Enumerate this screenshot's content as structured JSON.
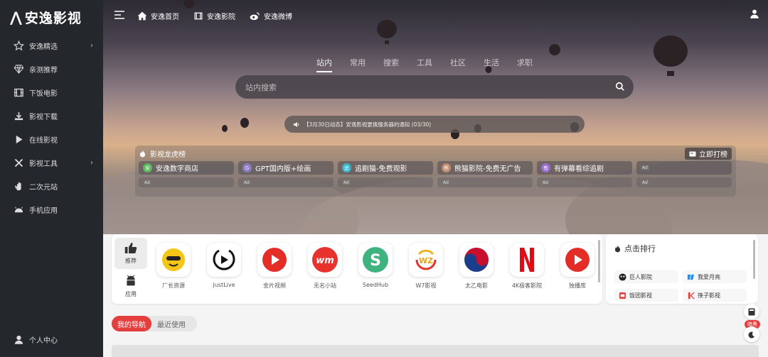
{
  "sidebar": {
    "logo": "安逸影视",
    "items": [
      {
        "label": "安逸精选",
        "has_arrow": true
      },
      {
        "label": "亲测推荐",
        "has_arrow": false
      },
      {
        "label": "下饭电影",
        "has_arrow": false
      },
      {
        "label": "影视下载",
        "has_arrow": false
      },
      {
        "label": "在线影视",
        "has_arrow": false
      },
      {
        "label": "影视工具",
        "has_arrow": true
      },
      {
        "label": "二次元站",
        "has_arrow": false
      },
      {
        "label": "手机应用",
        "has_arrow": false
      }
    ],
    "user_center": "个人中心"
  },
  "topnav": {
    "home": "安逸首页",
    "movies": "安逸影院",
    "weibo": "安逸微博"
  },
  "search": {
    "tabs": [
      "站内",
      "常用",
      "搜索",
      "工具",
      "社区",
      "生活",
      "求职"
    ],
    "active_tab": 0,
    "placeholder": "站内搜索"
  },
  "notice": "【3月30日动态】安逸影视更换服务器的通知 (03/30)",
  "ranking": {
    "title": "影视龙虎榜",
    "button": "立即打榜",
    "items": [
      {
        "label": "安逸数字商店",
        "color": "#5cb85c",
        "glyph": "安"
      },
      {
        "label": "GPT国内版+绘画",
        "color": "#8e7cc3",
        "glyph": "G"
      },
      {
        "label": "追剧猫-免费观影",
        "color": "#3cb4c8",
        "glyph": "追"
      },
      {
        "label": "熊猫影院-免费无广告",
        "color": "#c58a6a",
        "glyph": "熊"
      },
      {
        "label": "有弹幕看综追剧",
        "color": "#9b6fd0",
        "glyph": "有"
      }
    ],
    "ad_label": "Ad"
  },
  "apps": {
    "tabs": [
      {
        "label": "推荐"
      },
      {
        "label": "应用"
      }
    ],
    "items": [
      {
        "label": "厂长资源",
        "icon": "cartoon-icon",
        "color": "#f5c518"
      },
      {
        "label": "JustLive",
        "icon": "play-icon",
        "color": "#111111"
      },
      {
        "label": "金片视频",
        "icon": "play-icon",
        "color": "#e52d27"
      },
      {
        "label": "无名小站",
        "icon": "wm-icon",
        "color": "#e8322e"
      },
      {
        "label": "SeedHub",
        "icon": "s-icon",
        "color": "#3fb37f"
      },
      {
        "label": "W7影视",
        "icon": "wz-icon",
        "color": "#e8a317"
      },
      {
        "label": "太乙电影",
        "icon": "taiji-icon",
        "color": "#c8102e"
      },
      {
        "label": "4K极客影院",
        "icon": "n-icon",
        "color": "#e50914"
      },
      {
        "label": "独播库",
        "icon": "play-icon",
        "color": "#e52d27"
      }
    ]
  },
  "hot": {
    "title": "点击排行",
    "items": [
      {
        "label": "巨人影院",
        "color": "#222222"
      },
      {
        "label": "我爱月亮",
        "color": "#1e90ff"
      },
      {
        "label": "饭团影视",
        "color": "#e53e3e"
      },
      {
        "label": "筷子影视",
        "color": "#e53e3e"
      }
    ]
  },
  "navtabs": {
    "mine": "我的导航",
    "recent": "最近使用"
  },
  "float": {
    "badge": "暗黑"
  }
}
